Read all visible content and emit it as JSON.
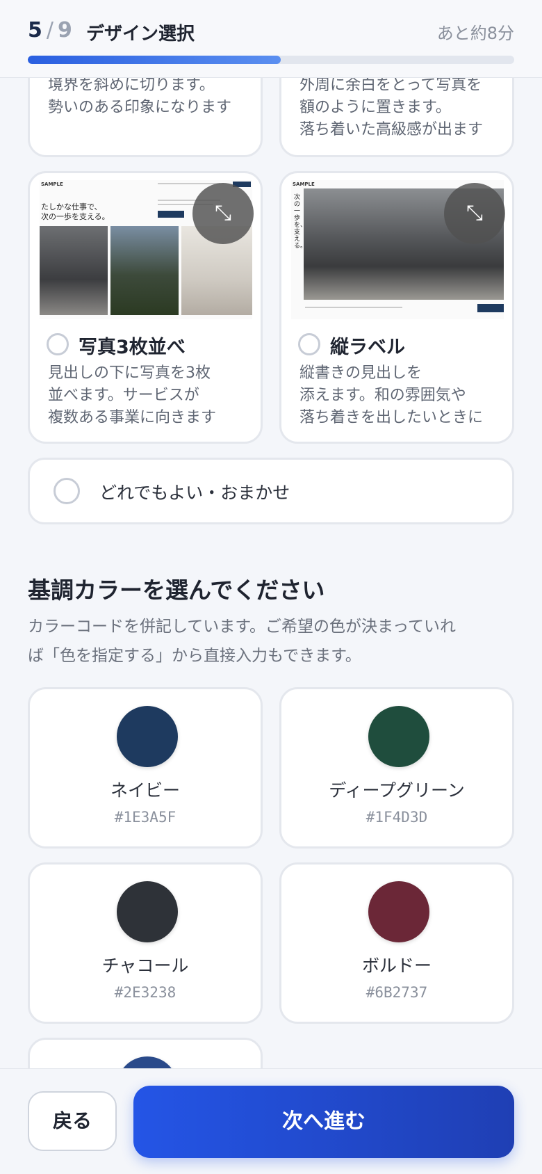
{
  "header": {
    "step_current": "5",
    "step_separator": "/",
    "step_total": "9",
    "title": "デザイン選択",
    "eta": "あと約8分",
    "progress": 0.52
  },
  "layouts": {
    "top_left_desc": [
      "境界を斜めに切ります。",
      "勢いのある印象になります"
    ],
    "top_right_desc": [
      "外周に余白をとって写真を",
      "額のように置きます。",
      "落ち着いた高級感が出ます"
    ],
    "three_photos": {
      "title": "写真3枚並べ",
      "desc": [
        "見出しの下に写真を3枚",
        "並べます。サービスが",
        "複数ある事業に向きます"
      ],
      "thumb": {
        "brand": "SAMPLE",
        "headline": [
          "たしかな仕事で、",
          "次の一歩を支える。"
        ]
      }
    },
    "vertical_label": {
      "title": "縦ラベル",
      "desc": [
        "縦書きの見出しを",
        "添えます。和の雰囲気や",
        "落ち着きを出したいときに"
      ],
      "thumb": {
        "brand": "SAMPLE",
        "vertical": "次の一歩を、支える。"
      }
    },
    "any": "どれでもよい・おまかせ"
  },
  "colors_section": {
    "title": "基調カラーを選んでください",
    "subtitle": [
      "カラーコードを併記しています。ご希望の色が決まっていれ",
      "ば「色を指定する」から直接入力もできます。"
    ],
    "items": [
      {
        "name": "ネイビー",
        "hex": "#1E3A5F"
      },
      {
        "name": "ディープグリーン",
        "hex": "#1F4D3D"
      },
      {
        "name": "チャコール",
        "hex": "#2E3238"
      },
      {
        "name": "ボルドー",
        "hex": "#6B2737"
      }
    ],
    "partial_swatch": "#2A4A8A"
  },
  "footer": {
    "back": "戻る",
    "next": "次へ進む"
  }
}
